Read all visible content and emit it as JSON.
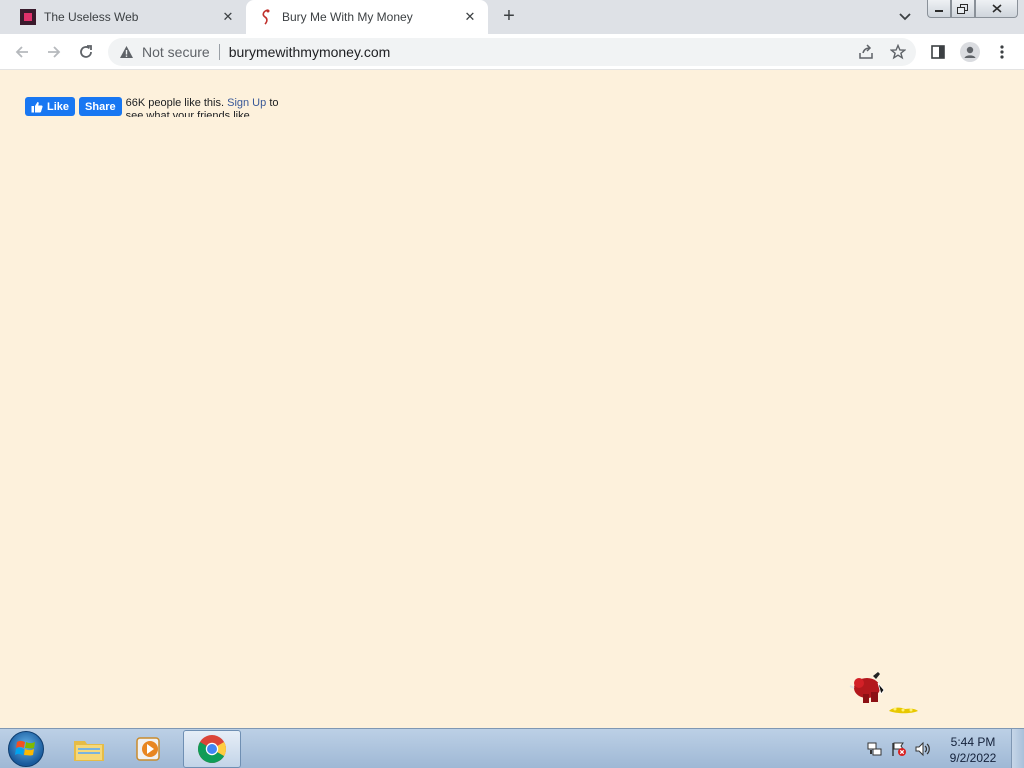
{
  "browser": {
    "tabs": [
      {
        "title": "The Useless Web",
        "active": false,
        "favicon": "useless-web-favicon"
      },
      {
        "title": "Bury Me With My Money",
        "active": true,
        "favicon": "bury-me-favicon"
      }
    ],
    "new_tab_label": "+",
    "address_bar": {
      "security_text": "Not secure",
      "url": "burymewithmymoney.com"
    }
  },
  "page": {
    "background_color": "#fdf1dc",
    "facebook": {
      "like_label": "Like",
      "share_label": "Share",
      "count_text": "66K people like this.",
      "signup_text": "Sign Up",
      "tail_text": "to see what your friends like."
    }
  },
  "taskbar": {
    "pinned": [
      "windows-explorer",
      "media-player",
      "google-chrome"
    ],
    "active_app": "google-chrome",
    "clock": {
      "time": "5:44 PM",
      "date": "9/2/2022"
    }
  }
}
